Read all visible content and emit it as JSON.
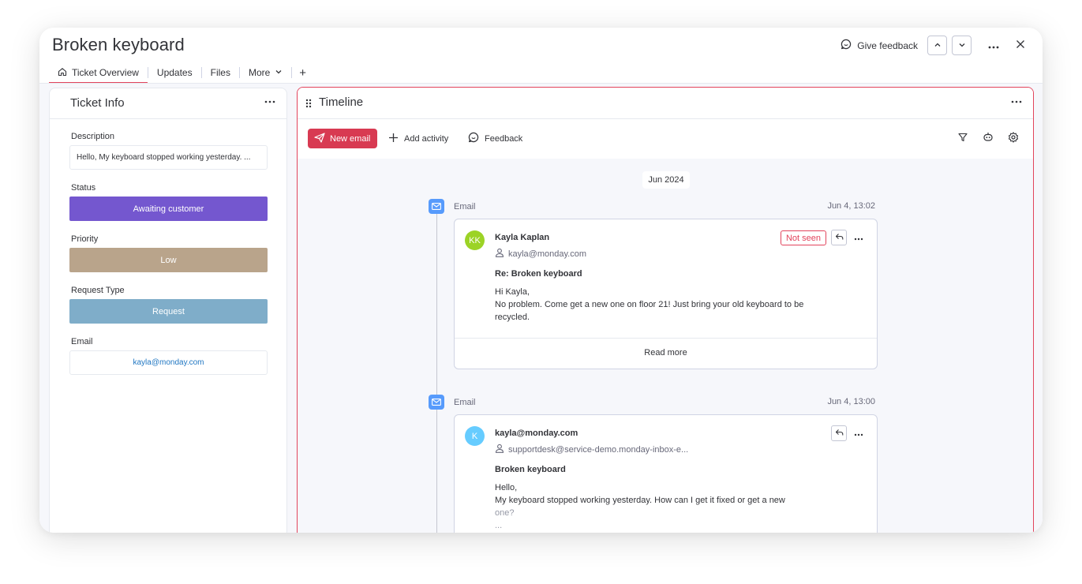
{
  "header": {
    "title": "Broken keyboard",
    "give_feedback": "Give feedback"
  },
  "tabs": [
    {
      "label": "Ticket Overview"
    },
    {
      "label": "Updates"
    },
    {
      "label": "Files"
    },
    {
      "label": "More"
    }
  ],
  "tab_add": "+",
  "ticket_info": {
    "title": "Ticket Info",
    "description_label": "Description",
    "description_value": "Hello, My keyboard stopped working yesterday. ...",
    "status_label": "Status",
    "status_value": "Awaiting customer",
    "status_color": "#7457cf",
    "priority_label": "Priority",
    "priority_value": "Low",
    "priority_color": "#b9a48b",
    "request_type_label": "Request Type",
    "request_type_value": "Request",
    "request_type_color": "#7fadc9",
    "email_label": "Email",
    "email_value": "kayla@monday.com"
  },
  "timeline": {
    "title": "Timeline",
    "new_email": "New email",
    "add_activity": "Add activity",
    "feedback": "Feedback",
    "date_group": "Jun 2024",
    "entries": [
      {
        "type": "Email",
        "time": "Jun 4, 13:02",
        "avatar_initials": "KK",
        "avatar_color": "#9cd326",
        "sender": "Kayla Kaplan",
        "sender_email": "kayla@monday.com",
        "badge": "Not seen",
        "subject": "Re: Broken keyboard",
        "body_line1": "Hi Kayla,",
        "body_line2": "No problem. Come get a new one on floor 21! Just bring your old keyboard to be recycled.",
        "read_more": "Read more"
      },
      {
        "type": "Email",
        "time": "Jun 4, 13:00",
        "avatar_initials": "K",
        "avatar_color": "#66ccff",
        "sender": "kayla@monday.com",
        "sender_email": "supportdesk@service-demo.monday-inbox-e...",
        "subject": "Broken keyboard",
        "body_line1": "Hello,",
        "body_line2": "My keyboard stopped working yesterday. How can I get it fixed or get a new",
        "body_line3": "one?",
        "body_line4": "..."
      }
    ]
  },
  "colors": {
    "accent": "#e2445c",
    "new_email_button": "#d83a52",
    "email_marker": "#579bfc"
  }
}
